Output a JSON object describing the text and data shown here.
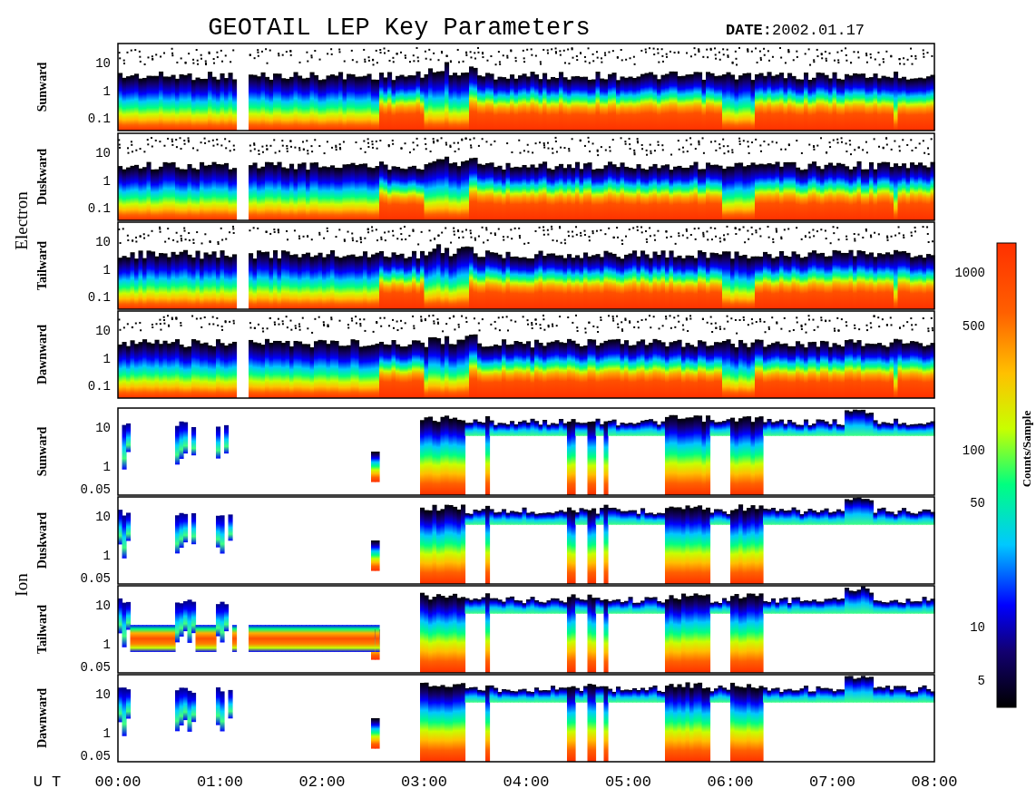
{
  "title": "GEOTAIL LEP Key Parameters",
  "date": {
    "label": "DATE:",
    "value": "2002.01.17"
  },
  "species": [
    {
      "name": "Electron",
      "panels": [
        {
          "label": "Sunward",
          "yticks": [
            "10",
            "1",
            "0.1"
          ]
        },
        {
          "label": "Duskward",
          "yticks": [
            "10",
            "1",
            "0.1"
          ]
        },
        {
          "label": "Tailward",
          "yticks": [
            "10",
            "1",
            "0.1"
          ]
        },
        {
          "label": "Dawnward",
          "yticks": [
            "10",
            "1",
            "0.1"
          ]
        }
      ]
    },
    {
      "name": "Ion",
      "panels": [
        {
          "label": "Sunward",
          "yticks": [
            "10",
            "1",
            "0.05"
          ]
        },
        {
          "label": "Duskward",
          "yticks": [
            "10",
            "1",
            "0.05"
          ]
        },
        {
          "label": "Tailward",
          "yticks": [
            "10",
            "1",
            "0.05"
          ]
        },
        {
          "label": "Dawnward",
          "yticks": [
            "10",
            "1",
            "0.05"
          ]
        }
      ]
    }
  ],
  "time_axis": {
    "label": "U T",
    "ticks": [
      "00:00",
      "01:00",
      "02:00",
      "03:00",
      "04:00",
      "05:00",
      "06:00",
      "07:00",
      "08:00"
    ]
  },
  "colorbar": {
    "label": "Counts/Sample",
    "ticks": [
      "1000",
      "500",
      "100",
      "50",
      "10",
      "5"
    ]
  }
}
